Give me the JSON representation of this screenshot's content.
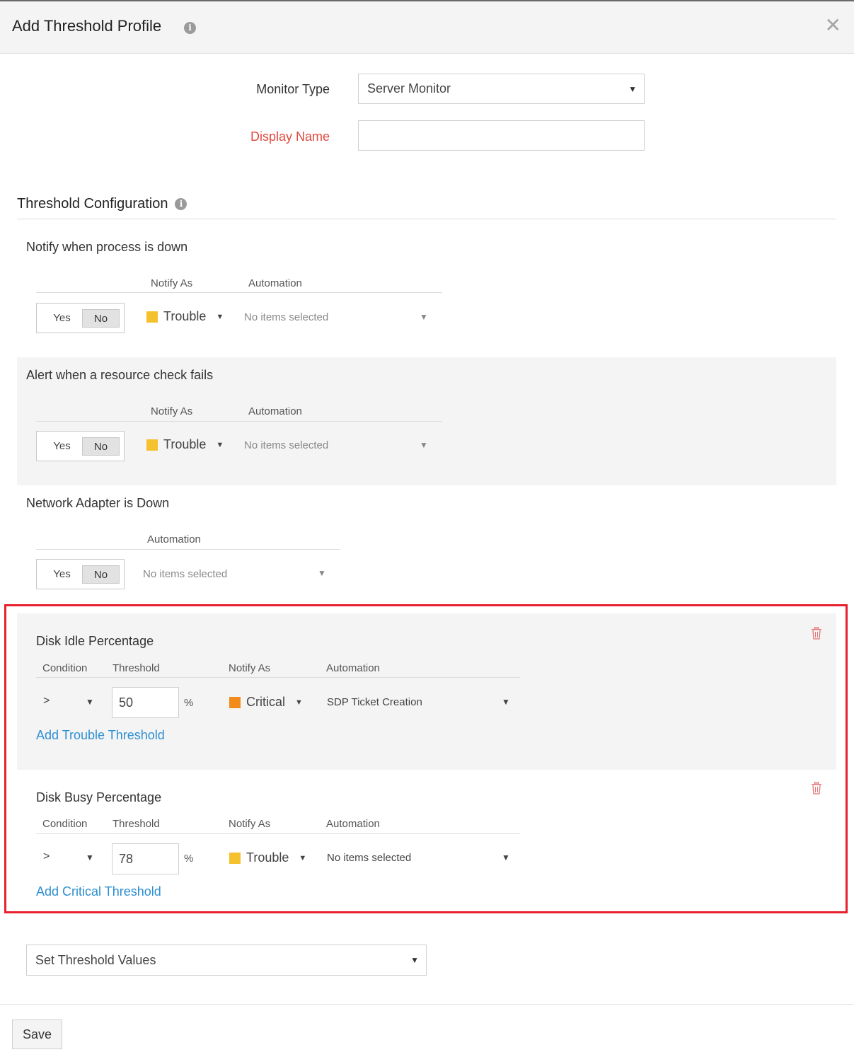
{
  "header": {
    "title": "Add Threshold Profile",
    "info_icon": "info-icon",
    "close_icon": "close-icon",
    "close_glyph": "✕"
  },
  "form": {
    "monitor_type_label": "Monitor Type",
    "monitor_type_value": "Server Monitor",
    "display_name_label": "Display Name",
    "display_name_value": ""
  },
  "threshold_config": {
    "title": "Threshold Configuration",
    "process_down": {
      "title": "Notify when process is down",
      "notify_as_header": "Notify As",
      "automation_header": "Automation",
      "yes": "Yes",
      "no": "No",
      "notify_as": "Trouble",
      "automation": "No items selected"
    },
    "resource_check": {
      "title": "Alert when a resource check fails",
      "notify_as_header": "Notify As",
      "automation_header": "Automation",
      "yes": "Yes",
      "no": "No",
      "notify_as": "Trouble",
      "automation": "No items selected"
    },
    "network_adapter": {
      "title": "Network Adapter is Down",
      "automation_header": "Automation",
      "yes": "Yes",
      "no": "No",
      "automation": "No items selected"
    },
    "disk_idle": {
      "title": "Disk Idle Percentage",
      "condition_header": "Condition",
      "threshold_header": "Threshold",
      "notify_as_header": "Notify As",
      "automation_header": "Automation",
      "condition": ">",
      "threshold": "50",
      "unit": "%",
      "notify_as": "Critical",
      "automation": "SDP Ticket Creation",
      "add_link": "Add Trouble Threshold"
    },
    "disk_busy": {
      "title": "Disk Busy Percentage",
      "condition_header": "Condition",
      "threshold_header": "Threshold",
      "notify_as_header": "Notify As",
      "automation_header": "Automation",
      "condition": ">",
      "threshold": "78",
      "unit": "%",
      "notify_as": "Trouble",
      "automation": "No items selected",
      "add_link": "Add Critical Threshold"
    },
    "set_threshold_values": "Set Threshold Values"
  },
  "footer": {
    "save_label": "Save"
  },
  "colors": {
    "trouble": "#f6c12f",
    "critical": "#f28b1c",
    "link": "#2d8fd2",
    "required": "#e04a3f",
    "highlight": "#e8202e"
  }
}
